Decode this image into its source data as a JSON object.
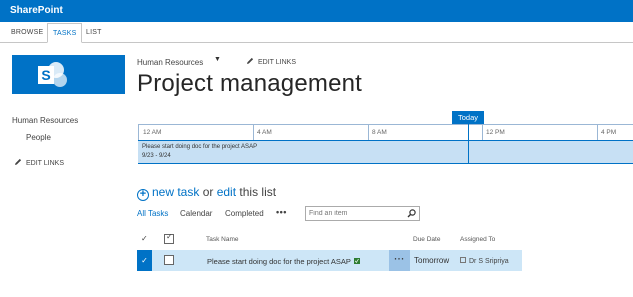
{
  "suite": {
    "brand": "SharePoint"
  },
  "ribbon": {
    "tabs": [
      "BROWSE",
      "TASKS",
      "LIST"
    ],
    "active": "TASKS"
  },
  "site": {
    "breadcrumb": "Human Resources",
    "edit_links": "EDIT LINKS",
    "page_title": "Project management"
  },
  "sidebar": {
    "title": "Human Resources",
    "items": [
      "People"
    ],
    "edit_links": "EDIT LINKS"
  },
  "timeline": {
    "today_label": "Today",
    "ticks": [
      "12 AM",
      "4 AM",
      "8 AM",
      "12 PM",
      "4 PM"
    ],
    "task_title": "Please start doing doc for the project ASAP",
    "task_dates": "9/23 - 9/24"
  },
  "new_task": {
    "prefix": "new task",
    "middle": " or ",
    "edit": "edit",
    "suffix": " this list"
  },
  "views": {
    "items": [
      "All Tasks",
      "Calendar",
      "Completed"
    ],
    "selected": "All Tasks",
    "more": "•••"
  },
  "search": {
    "placeholder": "Find an item",
    "value": ""
  },
  "table": {
    "headers": {
      "task_name": "Task Name",
      "due_date": "Due Date",
      "assigned_to": "Assigned To"
    },
    "rows": [
      {
        "task_name": "Please start doing doc for the project ASAP",
        "due_date": "Tomorrow",
        "assigned_to": "Dr S Sripriya",
        "selected": true
      }
    ]
  },
  "colors": {
    "accent": "#0072c6",
    "row_highlight": "#cde6f7",
    "timeline_bar": "#c7e0f4"
  }
}
